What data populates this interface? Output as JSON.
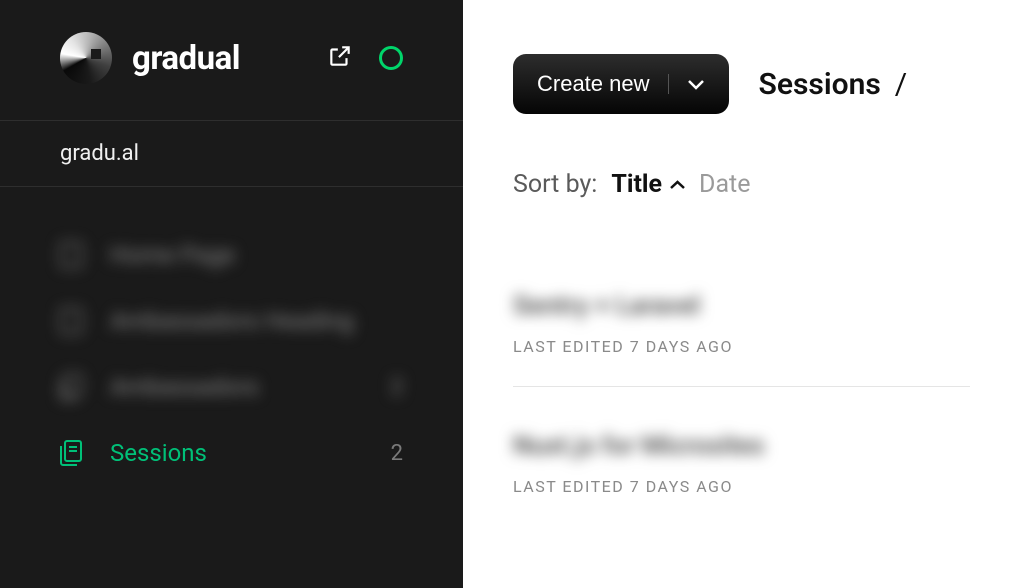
{
  "brand": {
    "name": "gradual"
  },
  "project": {
    "url": "gradu.al"
  },
  "sidebar": {
    "items": [
      {
        "label": "Home Page",
        "count": ""
      },
      {
        "label": "Ambassadors Heading",
        "count": ""
      },
      {
        "label": "Ambassadors",
        "count": "2"
      },
      {
        "label": "Sessions",
        "count": "2"
      }
    ]
  },
  "toolbar": {
    "create_label": "Create new"
  },
  "breadcrumb": {
    "item": "Sessions",
    "sep": "/"
  },
  "sort": {
    "label": "Sort by:",
    "options": [
      {
        "label": "Title",
        "active": true
      },
      {
        "label": "Date",
        "active": false
      }
    ]
  },
  "sessions": [
    {
      "title": "Sentry + Laravel",
      "meta": "LAST EDITED 7 DAYS AGO"
    },
    {
      "title": "Nuxt.js for Microsites",
      "meta": "LAST EDITED 7 DAYS AGO"
    }
  ]
}
